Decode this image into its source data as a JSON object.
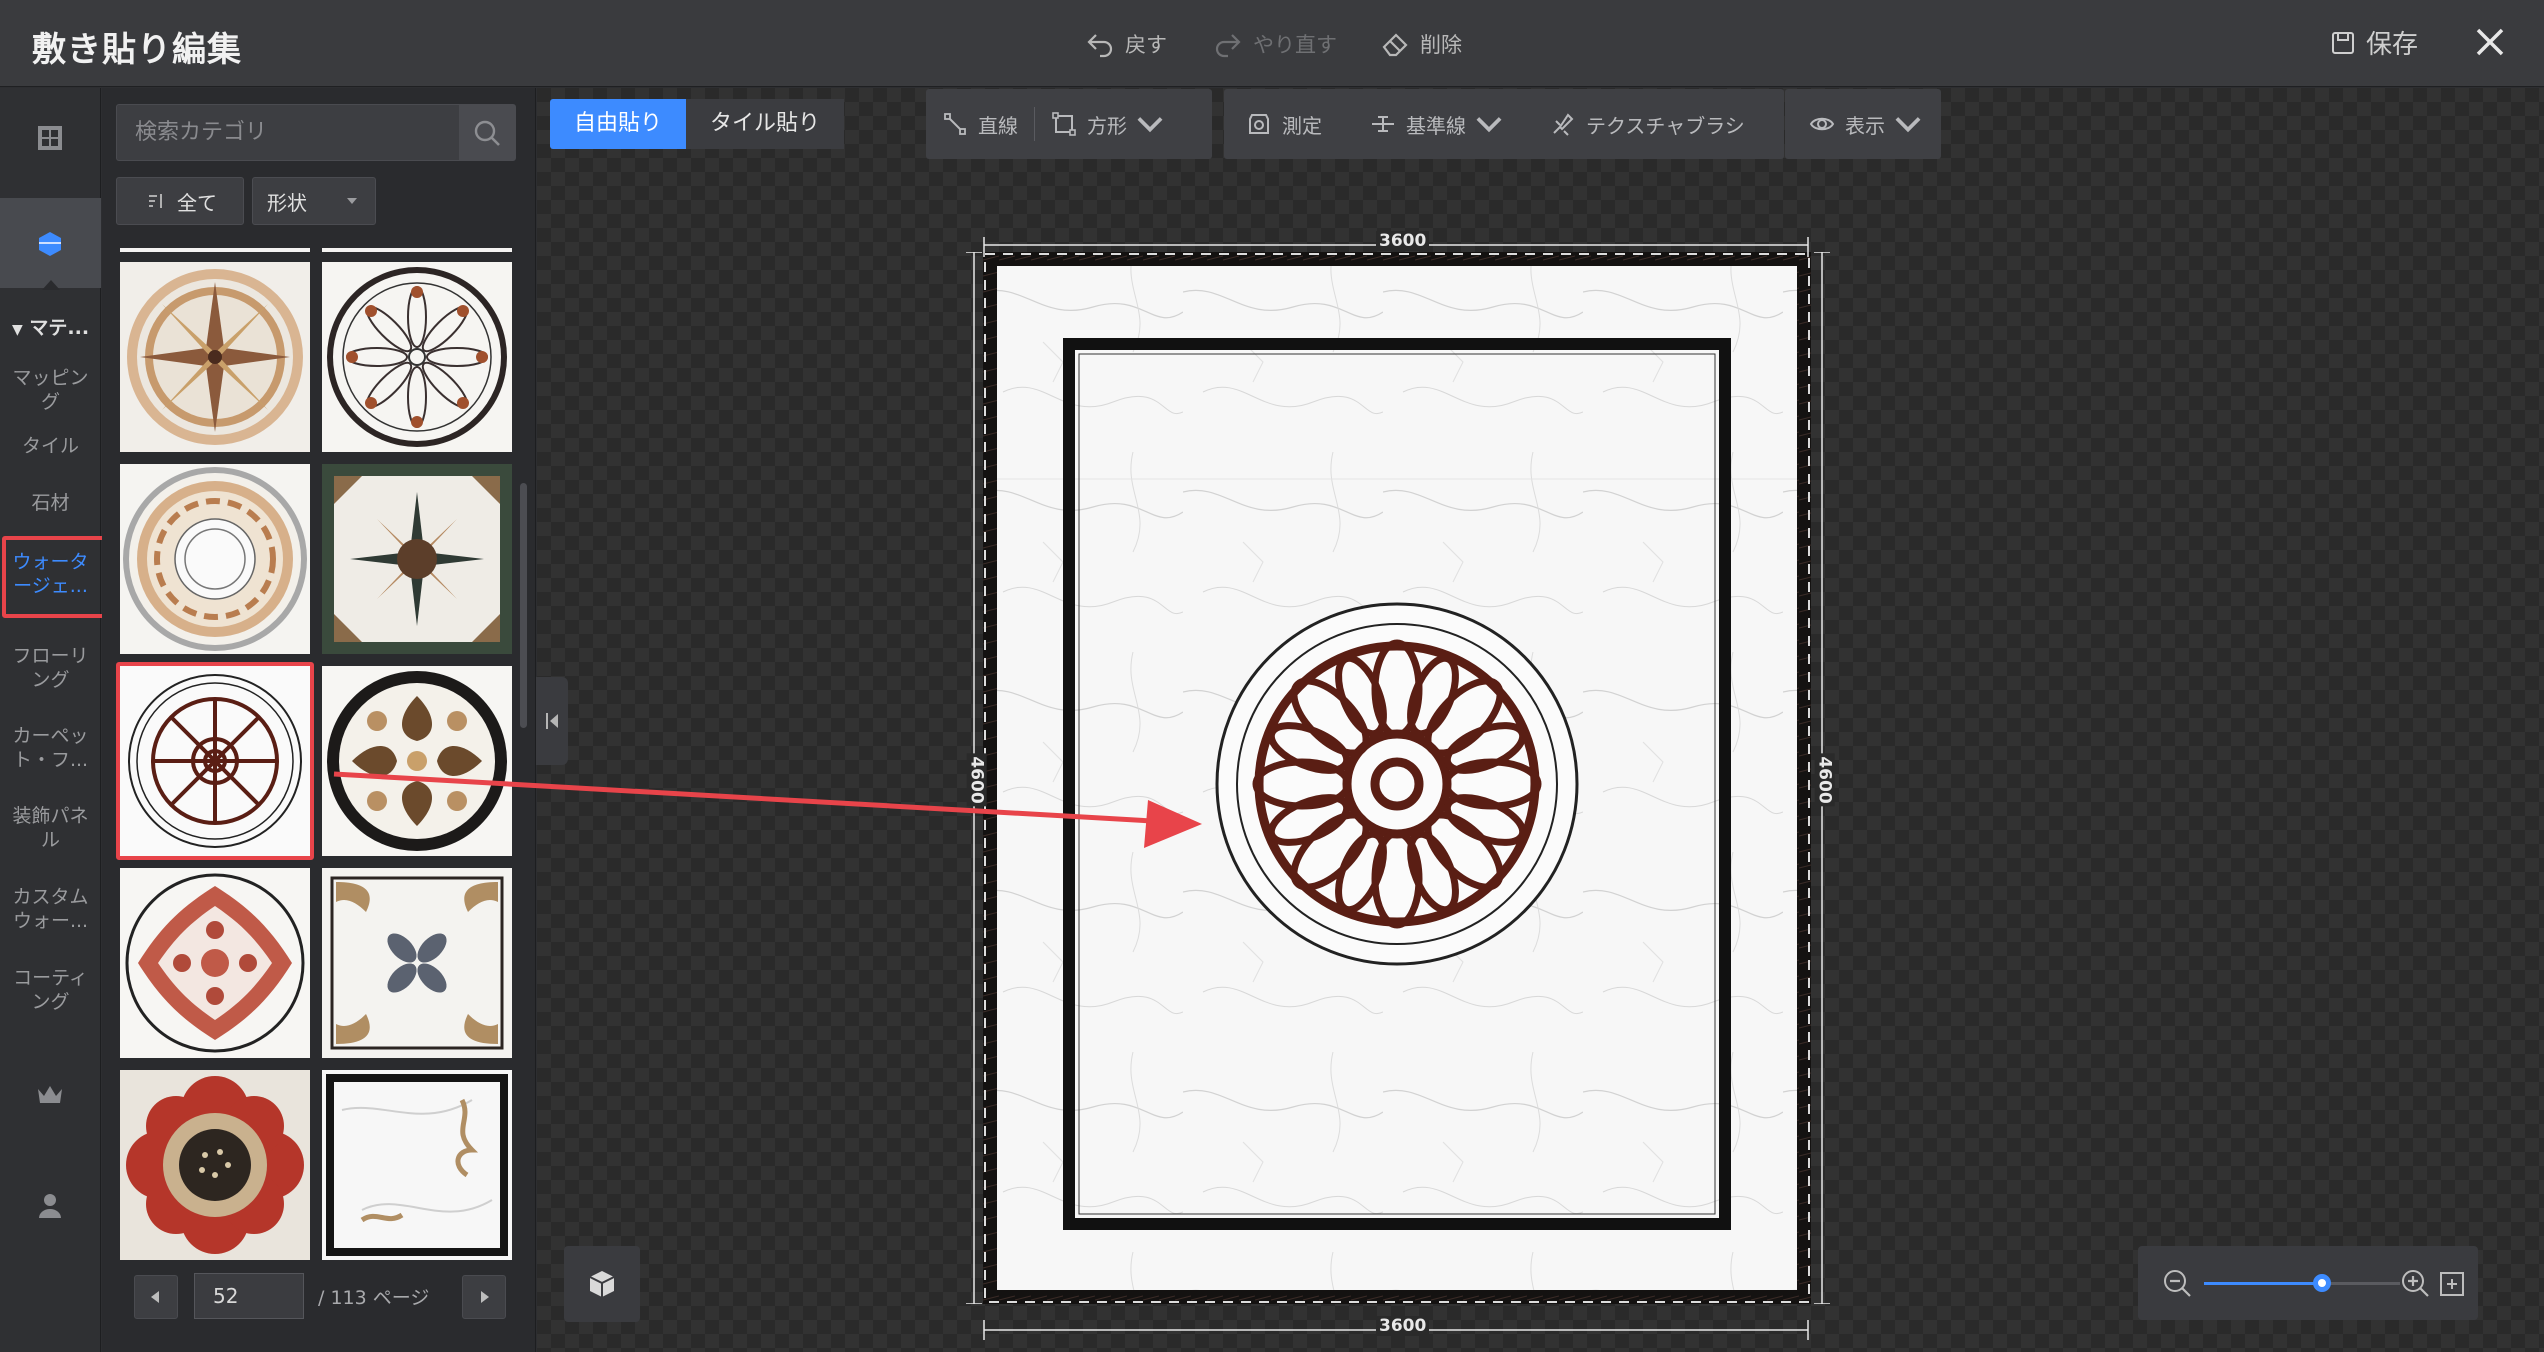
{
  "window": {
    "title": "敷き貼り編集",
    "undo_label": "戻す",
    "redo_label": "やり直す",
    "delete_label": "削除",
    "save_label": "保存"
  },
  "rail": {
    "section_header": "マテ...",
    "items": [
      {
        "label_line1": "マッピン",
        "label_line2": "グ"
      },
      {
        "label_line1": "タイル",
        "label_line2": ""
      },
      {
        "label_line1": "石材",
        "label_line2": ""
      },
      {
        "label_line1": "ウォータ",
        "label_line2": "ージェ..."
      },
      {
        "label_line1": "フローリ",
        "label_line2": "ング"
      },
      {
        "label_line1": "カーペッ",
        "label_line2": "ト・フ..."
      },
      {
        "label_line1": "装飾パネ",
        "label_line2": "ル"
      },
      {
        "label_line1": "カスタム",
        "label_line2": "ウォー..."
      },
      {
        "label_line1": "コーティ",
        "label_line2": "ング"
      }
    ]
  },
  "catalog": {
    "search_placeholder": "検索カテゴリ",
    "filter_all": "全て",
    "filter_shape": "形状",
    "page_current": "52",
    "page_total": "/ 113 ページ"
  },
  "toolbar": {
    "mode_free": "自由貼り",
    "mode_tile": "タイル貼り",
    "line": "直線",
    "rect": "方形",
    "measure": "測定",
    "baseline": "基準線",
    "texture_brush": "テクスチャブラシ",
    "view": "表示"
  },
  "floor": {
    "width_top": "3600",
    "width_bottom": "3600",
    "height_left": "4600",
    "height_right": "4600"
  },
  "zoom": {
    "level": 0.6
  },
  "colors": {
    "accent": "#3d8bff",
    "highlight": "#e8444a",
    "medallion": "#5a1e14"
  }
}
